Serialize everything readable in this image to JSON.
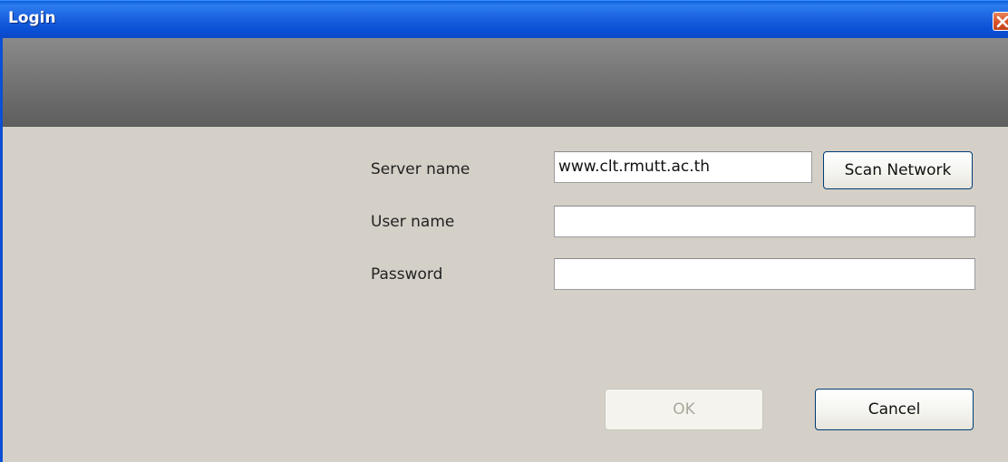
{
  "window": {
    "title": "Login"
  },
  "form": {
    "server_label": "Server name",
    "server_value": "www.clt.rmutt.ac.th",
    "scan_button": "Scan Network",
    "user_label": "User name",
    "user_value": "",
    "password_label": "Password",
    "password_value": ""
  },
  "actions": {
    "ok_label": "OK",
    "ok_enabled": false,
    "cancel_label": "Cancel"
  },
  "icons": {
    "close": "close-icon"
  },
  "colors": {
    "titlebar": "#0a4fd4",
    "close_button": "#d9542b",
    "header_band": "#6a6a6a",
    "dialog_background": "#d4d0c8"
  }
}
